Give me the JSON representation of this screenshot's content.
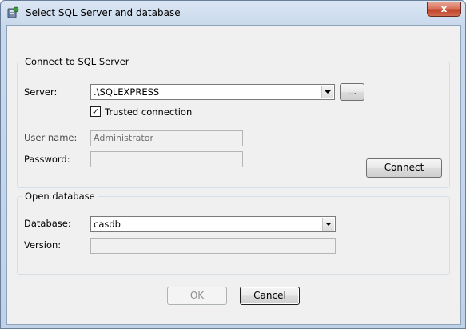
{
  "window": {
    "title": "Select SQL Server and database",
    "close_glyph": "x"
  },
  "connect_group": {
    "legend": "Connect to SQL Server",
    "server_label": "Server:",
    "server_value": ".\\SQLEXPRESS",
    "browse_label": "...",
    "trusted_label": "Trusted connection",
    "trusted_checked": true,
    "check_glyph": "✓",
    "username_label": "User name:",
    "username_value": "Administrator",
    "password_label": "Password:",
    "password_value": "",
    "connect_label": "Connect"
  },
  "database_group": {
    "legend": "Open database",
    "database_label": "Database:",
    "database_value": "casdb",
    "version_label": "Version:",
    "version_value": ""
  },
  "footer": {
    "ok_label": "OK",
    "cancel_label": "Cancel"
  }
}
